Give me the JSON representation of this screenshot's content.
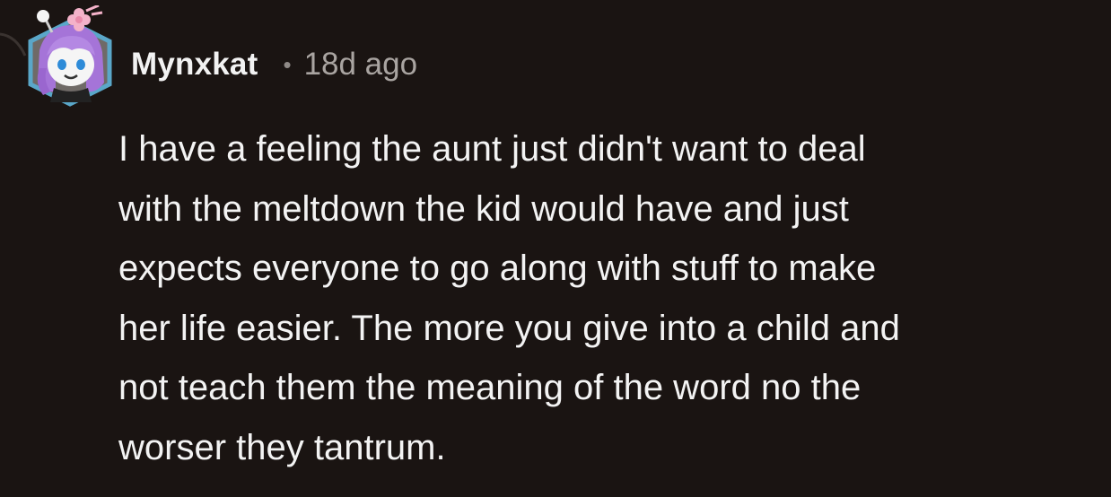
{
  "comment": {
    "author": "Mynxkat",
    "separator": "•",
    "time_ago": "18d ago",
    "avatar_icon": "snoo-avatar-icon",
    "thread_line_icon": "thread-connector-icon",
    "body_lines": [
      "I have a feeling the aunt just didn't want to deal",
      "with the meltdown the kid would have and just",
      "expects everyone to go along with stuff to make",
      "her life easier. The more you give into a child and",
      "not teach them the meaning of the word no the",
      "worser they tantrum."
    ]
  },
  "colors": {
    "background": "#1a1412",
    "text": "#f3f3f3",
    "meta": "#a9a4a1",
    "avatar_hair": "#a574d8",
    "avatar_border": "#5aa7c9",
    "flower": "#f4b2c9"
  }
}
